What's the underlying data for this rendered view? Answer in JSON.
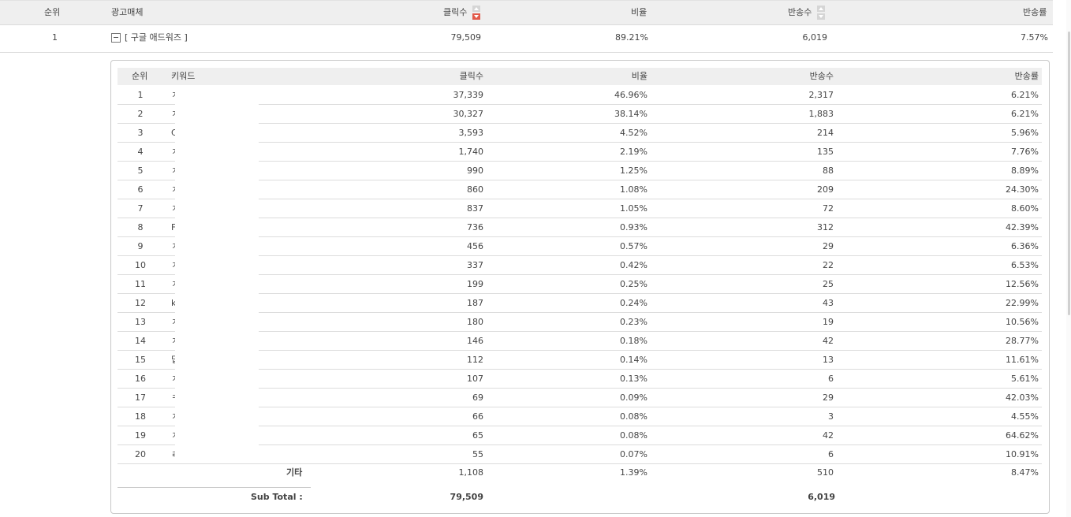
{
  "outer_header": {
    "rank": "순위",
    "media": "광고매체",
    "clicks": "클릭수",
    "ratio": "비율",
    "returns": "반송수",
    "return_rate": "반송률"
  },
  "outer_row": {
    "rank": "1",
    "media": "[ 구글 애드워즈 ]",
    "clicks": "79,509",
    "ratio": "89.21%",
    "returns": "6,019",
    "return_rate": "7.57%"
  },
  "inner_header": {
    "rank": "순위",
    "keyword": "키워드",
    "clicks": "클릭수",
    "ratio": "비율",
    "returns": "반송수",
    "return_rate": "반송률"
  },
  "rows": [
    {
      "rank": "1",
      "kw": "ㅈ",
      "clicks": "37,339",
      "ratio": "46.96%",
      "returns": "2,317",
      "rate": "6.21%"
    },
    {
      "rank": "2",
      "kw": "ㅈ",
      "clicks": "30,327",
      "ratio": "38.14%",
      "returns": "1,883",
      "rate": "6.21%"
    },
    {
      "rank": "3",
      "kw": "C",
      "clicks": "3,593",
      "ratio": "4.52%",
      "returns": "214",
      "rate": "5.96%"
    },
    {
      "rank": "4",
      "kw": "ㅈ",
      "clicks": "1,740",
      "ratio": "2.19%",
      "returns": "135",
      "rate": "7.76%"
    },
    {
      "rank": "5",
      "kw": "ㅈ",
      "clicks": "990",
      "ratio": "1.25%",
      "returns": "88",
      "rate": "8.89%"
    },
    {
      "rank": "6",
      "kw": "ㅈ",
      "clicks": "860",
      "ratio": "1.08%",
      "returns": "209",
      "rate": "24.30%"
    },
    {
      "rank": "7",
      "kw": "ㅈ",
      "clicks": "837",
      "ratio": "1.05%",
      "returns": "72",
      "rate": "8.60%"
    },
    {
      "rank": "8",
      "kw": "F",
      "clicks": "736",
      "ratio": "0.93%",
      "returns": "312",
      "rate": "42.39%"
    },
    {
      "rank": "9",
      "kw": "ㅈ",
      "clicks": "456",
      "ratio": "0.57%",
      "returns": "29",
      "rate": "6.36%"
    },
    {
      "rank": "10",
      "kw": "ㅈ",
      "clicks": "337",
      "ratio": "0.42%",
      "returns": "22",
      "rate": "6.53%"
    },
    {
      "rank": "11",
      "kw": "ㅈ",
      "clicks": "199",
      "ratio": "0.25%",
      "returns": "25",
      "rate": "12.56%"
    },
    {
      "rank": "12",
      "kw": "k",
      "clicks": "187",
      "ratio": "0.24%",
      "returns": "43",
      "rate": "22.99%"
    },
    {
      "rank": "13",
      "kw": "ㅈ",
      "clicks": "180",
      "ratio": "0.23%",
      "returns": "19",
      "rate": "10.56%"
    },
    {
      "rank": "14",
      "kw": "ㅈ",
      "clicks": "146",
      "ratio": "0.18%",
      "returns": "42",
      "rate": "28.77%"
    },
    {
      "rank": "15",
      "kw": "딥",
      "clicks": "112",
      "ratio": "0.14%",
      "returns": "13",
      "rate": "11.61%"
    },
    {
      "rank": "16",
      "kw": "ㅈ",
      "clicks": "107",
      "ratio": "0.13%",
      "returns": "6",
      "rate": "5.61%"
    },
    {
      "rank": "17",
      "kw": "ㅋ",
      "clicks": "69",
      "ratio": "0.09%",
      "returns": "29",
      "rate": "42.03%"
    },
    {
      "rank": "18",
      "kw": "ㅈ",
      "clicks": "66",
      "ratio": "0.08%",
      "returns": "3",
      "rate": "4.55%"
    },
    {
      "rank": "19",
      "kw": "ㅈ",
      "clicks": "65",
      "ratio": "0.08%",
      "returns": "42",
      "rate": "64.62%"
    },
    {
      "rank": "20",
      "kw": "ㄹ",
      "clicks": "55",
      "ratio": "0.07%",
      "returns": "6",
      "rate": "10.91%"
    }
  ],
  "etc": {
    "label": "기타",
    "clicks": "1,108",
    "ratio": "1.39%",
    "returns": "510",
    "rate": "8.47%"
  },
  "subtotal": {
    "label": "Sub Total :",
    "clicks": "79,509",
    "returns": "6,019"
  },
  "colors": {
    "header_bg": "#efefef",
    "sort_active": "#e25a4a",
    "border": "#dcdcdc"
  },
  "icons": {
    "sort_clicks": "sort-desc-icon",
    "sort_returns": "sort-icon",
    "toggle": "collapse-minus-icon"
  }
}
